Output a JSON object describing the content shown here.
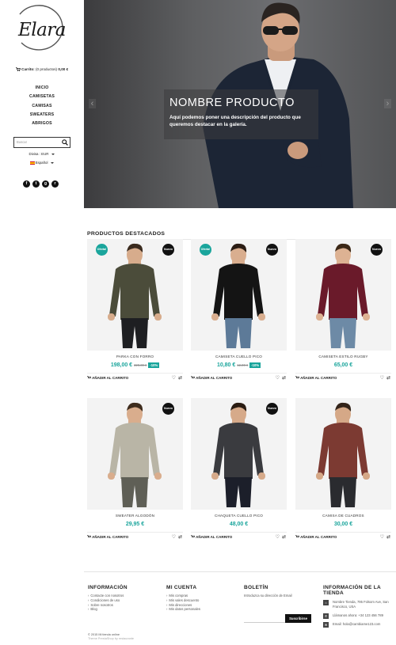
{
  "brand": {
    "logo_text": "Elara"
  },
  "sidebar": {
    "cart": {
      "label": "Carrito:",
      "count_text": "(0 productos)",
      "total": "0,00 €"
    },
    "nav": [
      "INICIO",
      "CAMISETAS",
      "CAMISAS",
      "SWEATERS",
      "ABRIGOS"
    ],
    "search_placeholder": "Buscar",
    "currency": "Divisa : EUR",
    "language": "Español",
    "social": [
      "facebook-icon",
      "twitter-icon",
      "google-plus-icon",
      "rss-icon"
    ]
  },
  "hero": {
    "title": "NOMBRE PRODUCTO",
    "description": "Aquí podemos poner una descripción del producto que queremos destacar en la galería."
  },
  "featured": {
    "heading": "PRODUCTOS DESTACADOS",
    "add_to_cart": "AÑADIR AL CARRITO",
    "products": [
      {
        "name": "PARKA CON FORRO",
        "price": "198,00 €",
        "old_price": "220,00 €",
        "discount": "-10%",
        "badges": [
          "Oferta!",
          "Nuevo"
        ],
        "top": "#4b4c3a",
        "bottom": "#1e1f22",
        "skin": "#d7ac8c",
        "hair": "#3a2a1e"
      },
      {
        "name": "CAMISETA CUELLO PICO",
        "price": "10,80 €",
        "old_price": "12,00 €",
        "discount": "-10%",
        "badges": [
          "Oferta!",
          "Nuevo"
        ],
        "top": "#141414",
        "bottom": "#5d7a98",
        "skin": "#d9ae8f",
        "hair": "#2b1d14"
      },
      {
        "name": "CAMISETA ESTILO RUGBY",
        "price": "65,00 €",
        "badges": [
          "Nuevo"
        ],
        "top": "#6a1a2a",
        "bottom": "#6d8aa6",
        "skin": "#ddb293",
        "hair": "#3c2817"
      },
      {
        "name": "SWEATER ALGODÓN",
        "price": "29,95 €",
        "badges": [
          "Nuevo"
        ],
        "top": "#b9b5a6",
        "bottom": "#5f5f56",
        "skin": "#d9ad8d",
        "hair": "#3e2c1d"
      },
      {
        "name": "CHAQUETA CUELLO PICO",
        "price": "48,00 €",
        "badges": [
          "Nuevo"
        ],
        "top": "#3a3b3f",
        "bottom": "#1c1f2a",
        "skin": "#d6aa8a",
        "hair": "#2a1c12"
      },
      {
        "name": "CAMISA DE CUADROS",
        "price": "30,00 €",
        "badges": [],
        "top": "#7c3a32",
        "bottom": "#2a2b2f",
        "skin": "#d5a887",
        "hair": "#33241a"
      }
    ]
  },
  "footer": {
    "info": {
      "title": "INFORMACIÓN",
      "items": [
        "Contacte con nosotros",
        "Condiciones de uso",
        "Sobre nosotros",
        "Blog"
      ]
    },
    "account": {
      "title": "MI CUENTA",
      "items": [
        "Mis compras",
        "Mis vales descuento",
        "Mis direcciones",
        "Mis datos personales"
      ]
    },
    "newsletter": {
      "title": "BOLETÍN",
      "text": "Introduzca su dirección de Email",
      "button": "Suscribirse"
    },
    "store": {
      "title": "INFORMACIÓN DE LA TIENDA",
      "address": "Nombre Tienda, 795 Folsom Ave, San Francisco, USA",
      "phone": "Llámanos ahora: +34 123 456 789",
      "email": "Email: hola@cambiame123.com"
    },
    "copyright": "© 2015 Mi tienda online",
    "theme": "Theme PrestaShop by restaurante"
  },
  "colors": {
    "accent": "#1aa59c",
    "dark": "#111111"
  }
}
